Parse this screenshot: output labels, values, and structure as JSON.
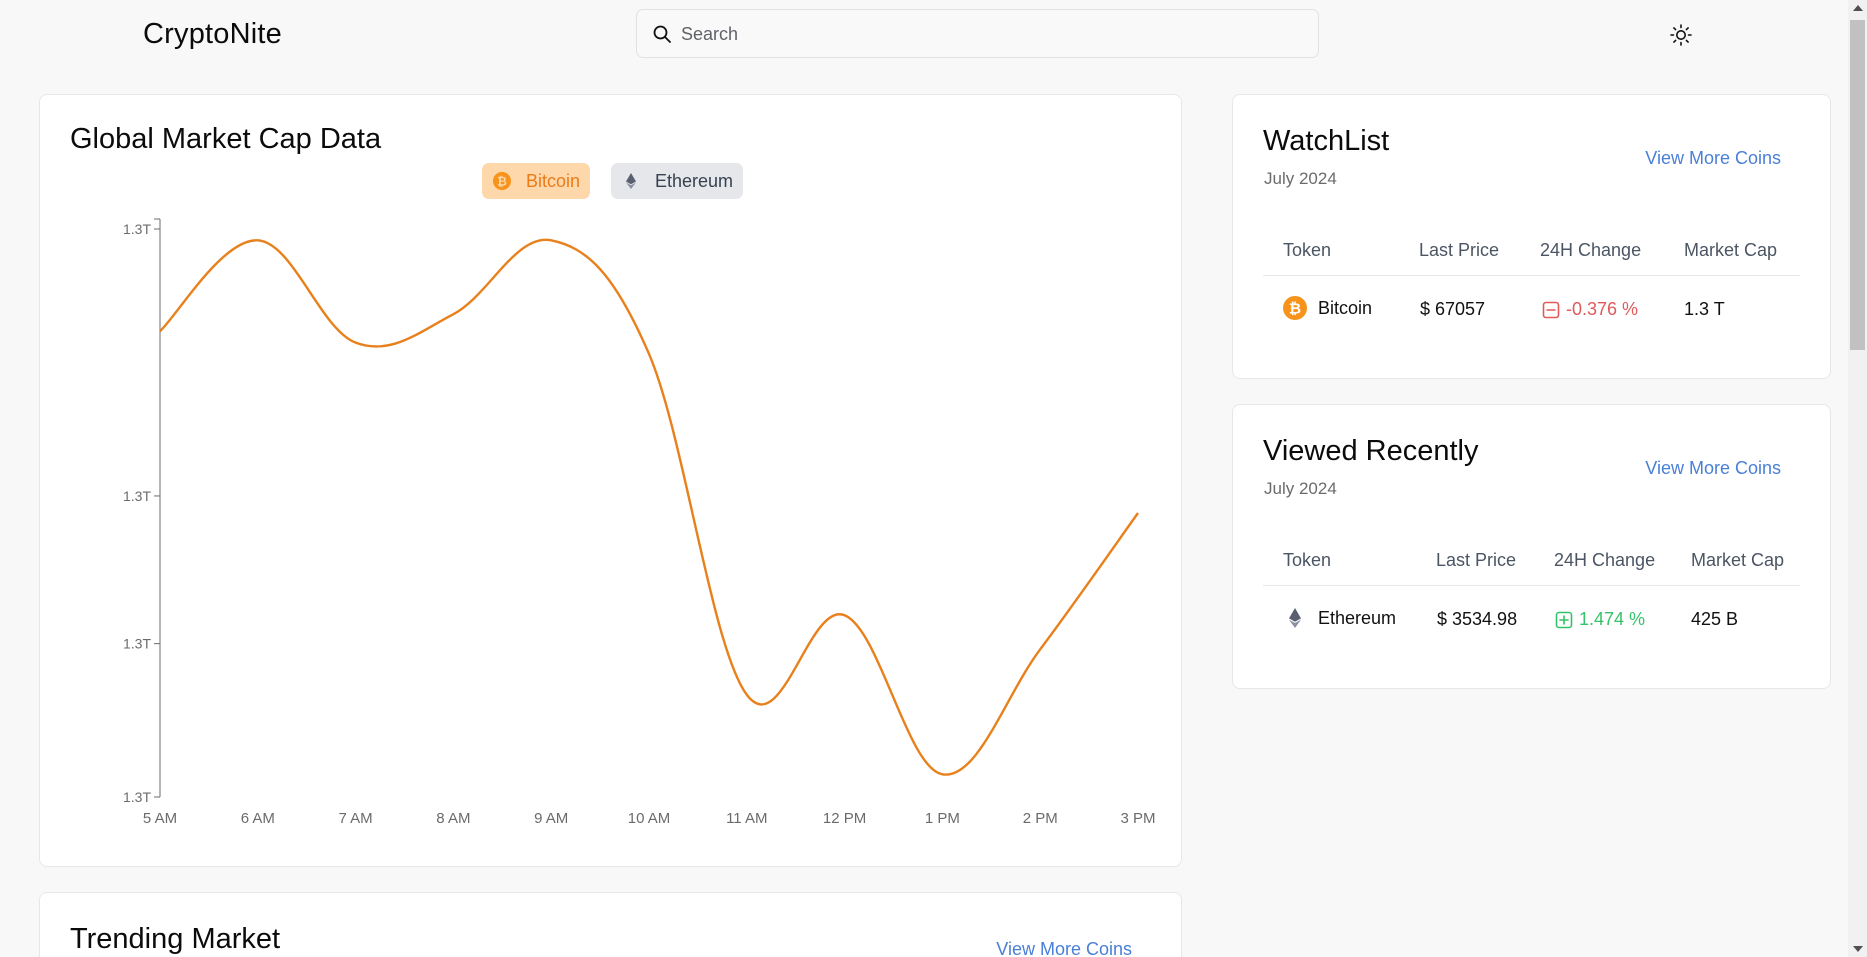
{
  "header": {
    "brand": "CryptoNite",
    "search_placeholder": "Search"
  },
  "chart_card": {
    "title": "Global Market Cap Data",
    "legend": [
      {
        "label": "Bitcoin",
        "icon": "bitcoin-icon",
        "color": "#ea7c1a",
        "active": true
      },
      {
        "label": "Ethereum",
        "icon": "ethereum-icon",
        "color": "#374151",
        "active": false
      }
    ]
  },
  "chart_data": {
    "type": "line",
    "x": [
      "5 AM",
      "6 AM",
      "7 AM",
      "8 AM",
      "9 AM",
      "10 AM",
      "11 AM",
      "12 PM",
      "1 PM",
      "2 PM",
      "3 PM"
    ],
    "series": [
      {
        "name": "Bitcoin",
        "color": "#e8801c",
        "values": [
          0.82,
          0.98,
          0.8,
          0.85,
          0.98,
          0.78,
          0.18,
          0.32,
          0.04,
          0.26,
          0.5
        ]
      }
    ],
    "y_ticks": [
      "1.3T",
      "1.3T",
      "1.3T",
      "1.3T"
    ],
    "y_tick_values": [
      1.0,
      0.53,
      0.27,
      0.0
    ],
    "ylim": [
      0,
      1
    ],
    "grid": false
  },
  "watchlist": {
    "title": "WatchList",
    "subtitle": "July 2024",
    "view_more": "View More Coins",
    "headers": [
      "Token",
      "Last Price",
      "24H Change",
      "Market Cap"
    ],
    "rows": [
      {
        "token": "Bitcoin",
        "icon": "bitcoin-icon",
        "price": "$ 67057",
        "change": "-0.376 %",
        "direction": "down",
        "market_cap": "1.3 T"
      }
    ]
  },
  "recent": {
    "title": "Viewed Recently",
    "subtitle": "July 2024",
    "view_more": "View More Coins",
    "headers": [
      "Token",
      "Last Price",
      "24H Change",
      "Market Cap"
    ],
    "rows": [
      {
        "token": "Ethereum",
        "icon": "ethereum-icon",
        "price": "$ 3534.98",
        "change": "1.474 %",
        "direction": "up",
        "market_cap": "425 B"
      }
    ]
  },
  "trending": {
    "title": "Trending Market",
    "view_more": "View More Coins"
  },
  "colors": {
    "accent_link": "#4a7fd8",
    "bitcoin": "#f7931a",
    "negative": "#e05a5a",
    "positive": "#34c36a"
  }
}
